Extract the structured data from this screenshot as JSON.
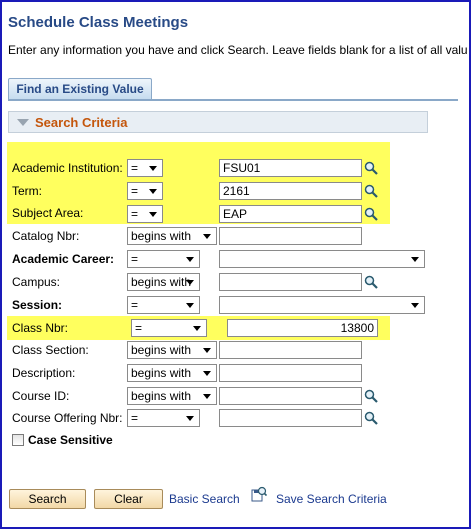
{
  "page": {
    "title": "Schedule Class Meetings",
    "instructions": "Enter any information you have and click Search. Leave fields blank for a list of all valu"
  },
  "tabs": [
    {
      "label": "Find an Existing Value",
      "active": true
    }
  ],
  "search_criteria": {
    "header": "Search Criteria",
    "fields": [
      {
        "label": "Academic Institution:",
        "operator": "=",
        "value": "FSU01",
        "highlighted": true
      },
      {
        "label": "Term:",
        "operator": "=",
        "value": "2161",
        "highlighted": true
      },
      {
        "label": "Subject Area:",
        "operator": "=",
        "value": "EAP",
        "highlighted": true
      },
      {
        "label": "Catalog Nbr:",
        "operator": "begins with",
        "value": ""
      },
      {
        "label": "Academic Career:",
        "operator": "=",
        "value": "",
        "bold": true
      },
      {
        "label": "Campus:",
        "operator": "begins with",
        "value": ""
      },
      {
        "label": "Session:",
        "operator": "=",
        "value": "",
        "bold": true
      },
      {
        "label": "Class Nbr:",
        "operator": "=",
        "value": "13800",
        "highlighted": true
      },
      {
        "label": "Class Section:",
        "operator": "begins with",
        "value": ""
      },
      {
        "label": "Description:",
        "operator": "begins with",
        "value": ""
      },
      {
        "label": "Course ID:",
        "operator": "begins with",
        "value": ""
      },
      {
        "label": "Course Offering Nbr:",
        "operator": "=",
        "value": ""
      }
    ],
    "case_sensitive": {
      "label": "Case Sensitive",
      "checked": false
    }
  },
  "actions": {
    "search": "Search",
    "clear": "Clear",
    "basic_search": "Basic Search",
    "save_search_criteria": "Save Search Criteria"
  },
  "colors": {
    "title": "#284a86",
    "section_header": "#c4560c",
    "highlight": "#ffff5e",
    "frame": "#1a1ab8"
  },
  "icons": [
    "collapse-triangle-icon",
    "magnifier-icon",
    "save-search-icon"
  ]
}
